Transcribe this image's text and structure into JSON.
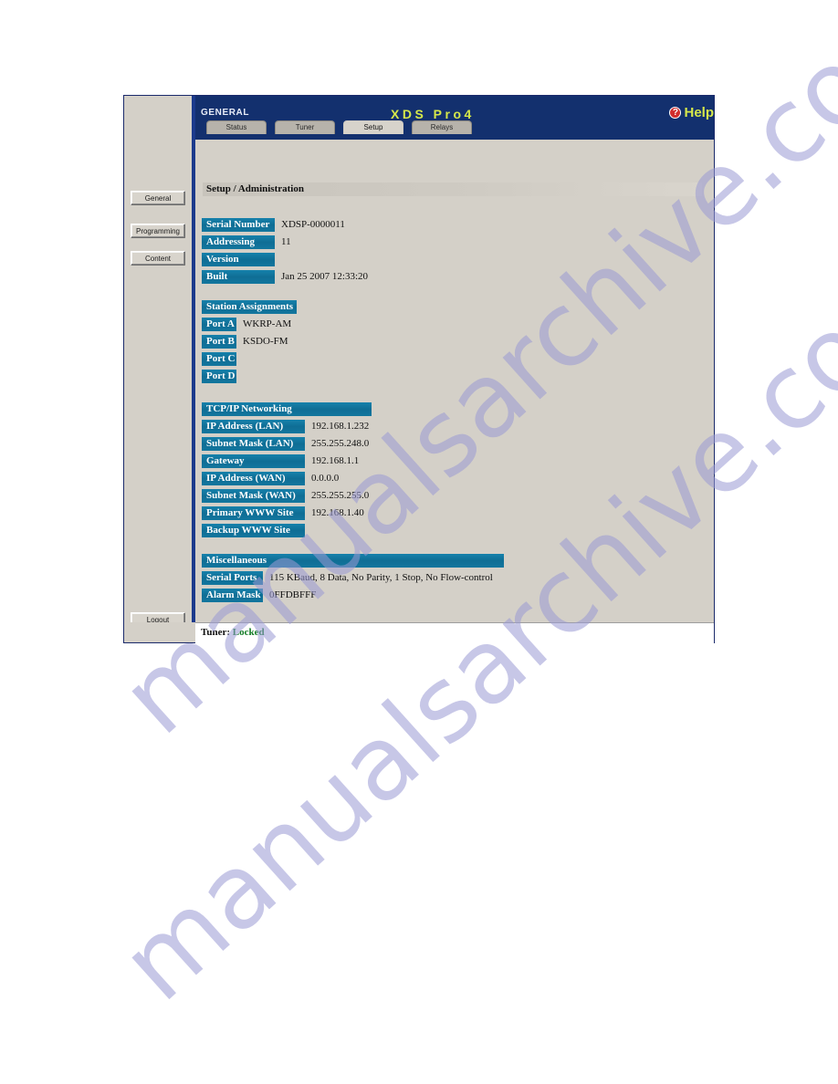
{
  "watermark": {
    "line1": "manualsarchive.com",
    "line2": "manualsarchive.com"
  },
  "header": {
    "system_label": "GENERAL",
    "brand_title": "XDS Pro4",
    "help_label": "Help",
    "help_icon_glyph": "?",
    "background_color": "#13306e",
    "accent_color": "#d6e84a"
  },
  "tabs": [
    {
      "label": "Status",
      "active": false
    },
    {
      "label": "Tuner",
      "active": false
    },
    {
      "label": "Setup",
      "active": true
    },
    {
      "label": "Relays",
      "active": false
    }
  ],
  "sidebar": {
    "items": [
      {
        "label": "General"
      },
      {
        "label": "Programming"
      },
      {
        "label": "Content"
      }
    ],
    "logout_label": "Logout"
  },
  "main": {
    "section_title": "Setup / Administration",
    "groups": [
      {
        "id": "info",
        "header": null,
        "rows": [
          {
            "label": "Serial Number",
            "value": "XDSP-0000011"
          },
          {
            "label": "Addressing",
            "value": "11"
          },
          {
            "label": "Version",
            "value": ""
          },
          {
            "label": "Built",
            "value": "Jan 25 2007 12:33:20"
          }
        ]
      },
      {
        "id": "station",
        "header": "Station Assignments",
        "rows": [
          {
            "label": "Port A",
            "value": "WKRP-AM"
          },
          {
            "label": "Port B",
            "value": "KSDO-FM"
          },
          {
            "label": "Port C",
            "value": ""
          },
          {
            "label": "Port D",
            "value": ""
          }
        ]
      },
      {
        "id": "tcpip",
        "header": "TCP/IP Networking",
        "rows": [
          {
            "label": "IP Address (LAN)",
            "value": "192.168.1.232"
          },
          {
            "label": "Subnet Mask (LAN)",
            "value": "255.255.248.0"
          },
          {
            "label": "Gateway",
            "value": "192.168.1.1"
          },
          {
            "label": "IP Address (WAN)",
            "value": "0.0.0.0"
          },
          {
            "label": "Subnet Mask (WAN)",
            "value": "255.255.255.0"
          },
          {
            "label": "Primary WWW Site",
            "value": "192.168.1.40"
          },
          {
            "label": "Backup WWW Site",
            "value": ""
          }
        ]
      },
      {
        "id": "misc",
        "header": "Miscellaneous",
        "rows": [
          {
            "label": "Serial Ports",
            "value": "115 KBaud, 8 Data, No Parity, 1 Stop, No Flow-control"
          },
          {
            "label": "Alarm Mask",
            "value": "0FFDBFFF"
          }
        ]
      }
    ]
  },
  "footer": {
    "tuner_label": "Tuner:",
    "tuner_status": "Locked",
    "tuner_status_color": "#0f7a22"
  },
  "colors": {
    "label_blue": "#12769e",
    "header_navy": "#13306e",
    "panel_gray": "#d4d0c8"
  }
}
